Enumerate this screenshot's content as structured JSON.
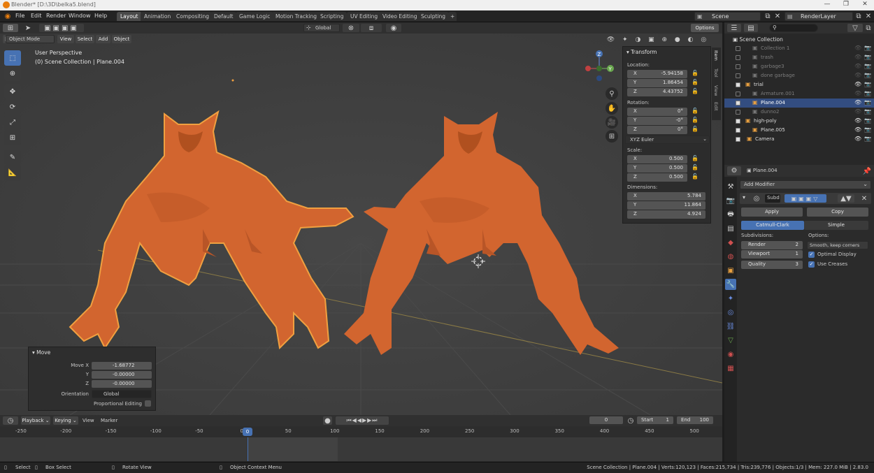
{
  "window": {
    "title": "Blender* [D:\\3D\\belka5.blend]",
    "minimize": "—",
    "maximize": "❐",
    "close": "✕"
  },
  "menu": [
    "File",
    "Edit",
    "Render",
    "Window",
    "Help"
  ],
  "workspaces": [
    "Layout",
    "Animation",
    "Compositing",
    "Default",
    "Game Logic",
    "Motion Tracking",
    "Scripting",
    "UV Editing",
    "Video Editing",
    "Sculpting"
  ],
  "workspace_add": "+",
  "scene": {
    "name": "Scene",
    "render_layer": "RenderLayer"
  },
  "toolbar": {
    "orientation": "Global",
    "options": "Options"
  },
  "viewport_header": {
    "mode": "Object Mode",
    "menus": [
      "View",
      "Select",
      "Add",
      "Object"
    ]
  },
  "viewport": {
    "perspective": "User Perspective",
    "collection_info": "(0) Scene Collection | Plane.004",
    "side_tabs": [
      "Item",
      "Tool",
      "View",
      "Edit"
    ],
    "axes": {
      "z": "Z",
      "y": "Y",
      "x": "X"
    }
  },
  "transform": {
    "title": "Transform",
    "location_label": "Location:",
    "location": [
      {
        "axis": "X",
        "value": "-5.94158"
      },
      {
        "axis": "Y",
        "value": "1.86454"
      },
      {
        "axis": "Z",
        "value": "4.43752"
      }
    ],
    "rotation_label": "Rotation:",
    "rotation": [
      {
        "axis": "X",
        "value": "0°"
      },
      {
        "axis": "Y",
        "value": "-0°"
      },
      {
        "axis": "Z",
        "value": "0°"
      }
    ],
    "rotation_mode": "XYZ Euler",
    "scale_label": "Scale:",
    "scale": [
      {
        "axis": "X",
        "value": "0.500"
      },
      {
        "axis": "Y",
        "value": "0.500"
      },
      {
        "axis": "Z",
        "value": "0.500"
      }
    ],
    "dimensions_label": "Dimensions:",
    "dimensions": [
      {
        "axis": "X",
        "value": "5.784"
      },
      {
        "axis": "Y",
        "value": "11.864"
      },
      {
        "axis": "Z",
        "value": "4.924"
      }
    ]
  },
  "move_panel": {
    "title": "Move",
    "rows": [
      {
        "label": "Move X",
        "value": "-1.68772"
      },
      {
        "label": "Y",
        "value": "-0.00000"
      },
      {
        "label": "Z",
        "value": "-0.00000"
      }
    ],
    "orientation_label": "Orientation",
    "orientation": "Global",
    "proportional_label": "Proportional Editing"
  },
  "outliner": {
    "root": "Scene Collection",
    "items": [
      {
        "label": "Collection 1",
        "dim": true
      },
      {
        "label": "trash",
        "dim": true
      },
      {
        "label": "garbage3",
        "dim": true
      },
      {
        "label": "done garbage",
        "dim": true
      },
      {
        "label": "trial",
        "dim": false
      },
      {
        "label": "Armature.001",
        "dim": true
      },
      {
        "label": "Plane.004",
        "dim": false,
        "selected": true
      },
      {
        "label": "dunno2",
        "dim": true
      },
      {
        "label": "high-poly",
        "dim": false
      },
      {
        "label": "Plane.005",
        "dim": false
      },
      {
        "label": "Camera",
        "dim": false
      }
    ]
  },
  "properties": {
    "object": "Plane.004",
    "add_modifier": "Add Modifier",
    "modifier_name": "Subd",
    "apply": "Apply",
    "copy": "Copy",
    "catmull": "Catmull-Clark",
    "simple": "Simple",
    "subdivisions_label": "Subdivisions:",
    "options_label": "Options:",
    "render_label": "Render",
    "render_value": "2",
    "viewport_label": "Viewport",
    "viewport_value": "1",
    "quality_label": "Quality",
    "quality_value": "3",
    "uv_smooth": "Smooth, keep corners",
    "optimal_display": "Optimal Display",
    "use_creases": "Use Creases"
  },
  "timeline": {
    "menus": [
      "Playback",
      "Keying",
      "View",
      "Marker"
    ],
    "current_frame": "0",
    "start_label": "Start",
    "start": "1",
    "end_label": "End",
    "end": "100",
    "ticks": [
      "-250",
      "-200",
      "-150",
      "-100",
      "-50",
      "0",
      "50",
      "100",
      "150",
      "200",
      "250",
      "300",
      "350",
      "400",
      "450",
      "500"
    ],
    "playhead": "0"
  },
  "status": {
    "select": "Select",
    "box_select": "Box Select",
    "rotate": "Rotate View",
    "context_menu": "Object Context Menu",
    "info": "Scene Collection | Plane.004 | Verts:120,123 | Faces:215,734 | Tris:239,776 | Objects:1/3 | Mem: 227.0 MiB | 2.83.0"
  },
  "colors": {
    "accent": "#4772b3",
    "model": "#d2652f",
    "selection": "#f0a040",
    "viewport_bg": "#3d3d3d"
  }
}
